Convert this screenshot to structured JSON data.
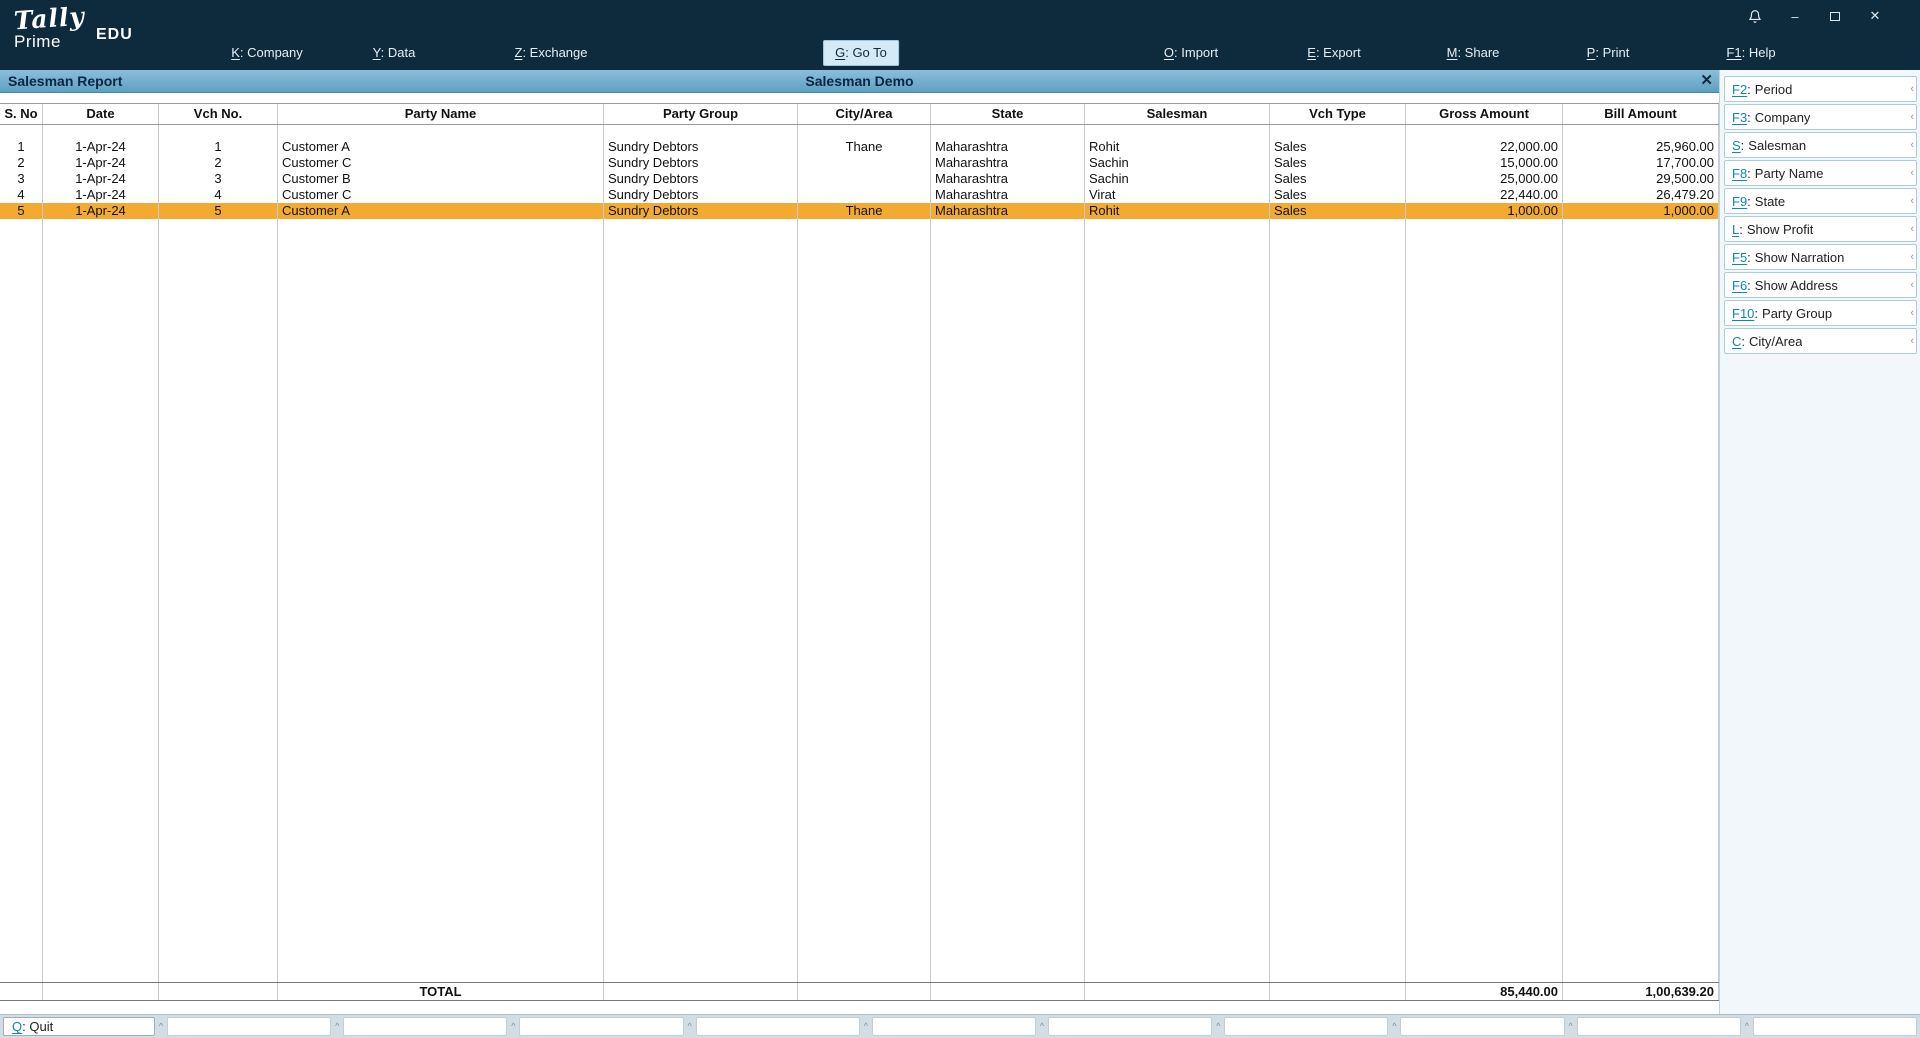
{
  "window": {
    "brand_script": "Tally",
    "brand_sub": "Prime",
    "edition": "EDU",
    "minimize_glyph": "–",
    "close_glyph": "✕"
  },
  "topbar": {
    "menus": [
      {
        "key": "K",
        "label": "Company",
        "active": false
      },
      {
        "key": "Y",
        "label": "Data",
        "active": false
      },
      {
        "key": "Z",
        "label": "Exchange",
        "active": false
      },
      {
        "key": "G",
        "label": "Go To",
        "active": true
      },
      {
        "key": "O",
        "label": "Import",
        "active": false
      },
      {
        "key": "E",
        "label": "Export",
        "active": false
      },
      {
        "key": "M",
        "label": "Share",
        "active": false
      },
      {
        "key": "P",
        "label": "Print",
        "active": false
      },
      {
        "key": "F1",
        "label": "Help",
        "active": false
      }
    ]
  },
  "titlebar": {
    "report_title": "Salesman Report",
    "company_name": "Salesman Demo",
    "close_glyph": "✕"
  },
  "table": {
    "columns": [
      "S. No",
      "Date",
      "Vch No.",
      "Party Name",
      "Party Group",
      "City/Area",
      "State",
      "Salesman",
      "Vch Type",
      "Gross Amount",
      "Bill Amount"
    ],
    "rows": [
      [
        "1",
        "1-Apr-24",
        "1",
        "Customer A",
        "Sundry Debtors",
        "Thane",
        "Maharashtra",
        "Rohit",
        "Sales",
        "22,000.00",
        "25,960.00"
      ],
      [
        "2",
        "1-Apr-24",
        "2",
        "Customer C",
        "Sundry Debtors",
        "",
        "Maharashtra",
        "Sachin",
        "Sales",
        "15,000.00",
        "17,700.00"
      ],
      [
        "3",
        "1-Apr-24",
        "3",
        "Customer B",
        "Sundry Debtors",
        "",
        "Maharashtra",
        "Sachin",
        "Sales",
        "25,000.00",
        "29,500.00"
      ],
      [
        "4",
        "1-Apr-24",
        "4",
        "Customer C",
        "Sundry Debtors",
        "",
        "Maharashtra",
        "Virat",
        "Sales",
        "22,440.00",
        "26,479.20"
      ],
      [
        "5",
        "1-Apr-24",
        "5",
        "Customer A",
        "Sundry Debtors",
        "Thane",
        "Maharashtra",
        "Rohit",
        "Sales",
        "1,000.00",
        "1,000.00"
      ]
    ],
    "selected_row": 5,
    "selected_row_color": "#F2AB30",
    "total": {
      "label": "TOTAL",
      "gross_amount": "85,440.00",
      "bill_amount": "1,00,639.20"
    }
  },
  "sidebar": {
    "chevron_glyph": "‹",
    "buttons": [
      {
        "key": "F2",
        "label": "Period"
      },
      {
        "key": "F3",
        "label": "Company"
      },
      {
        "key": "S",
        "label": "Salesman"
      },
      {
        "key": "F8",
        "label": "Party Name"
      },
      {
        "key": "F9",
        "label": "State"
      },
      {
        "key": "L",
        "label": "Show Profit"
      },
      {
        "key": "F5",
        "label": "Show Narration"
      },
      {
        "key": "F6",
        "label": "Show Address"
      },
      {
        "key": "F10",
        "label": "Party Group"
      },
      {
        "key": "C",
        "label": "City/Area"
      }
    ]
  },
  "bottombar": {
    "quit_key": "Q",
    "quit_label": "Quit",
    "empty_slots": 10,
    "caret_glyph": "^"
  },
  "colors": {
    "topbar_bg": "#0D2B3D",
    "titlebar_bg": "#6FABCB",
    "selected_row_bg": "#F2AB30",
    "shortcut_key": "#0F87B0",
    "active_menu_bg": "#D4EBF7"
  }
}
